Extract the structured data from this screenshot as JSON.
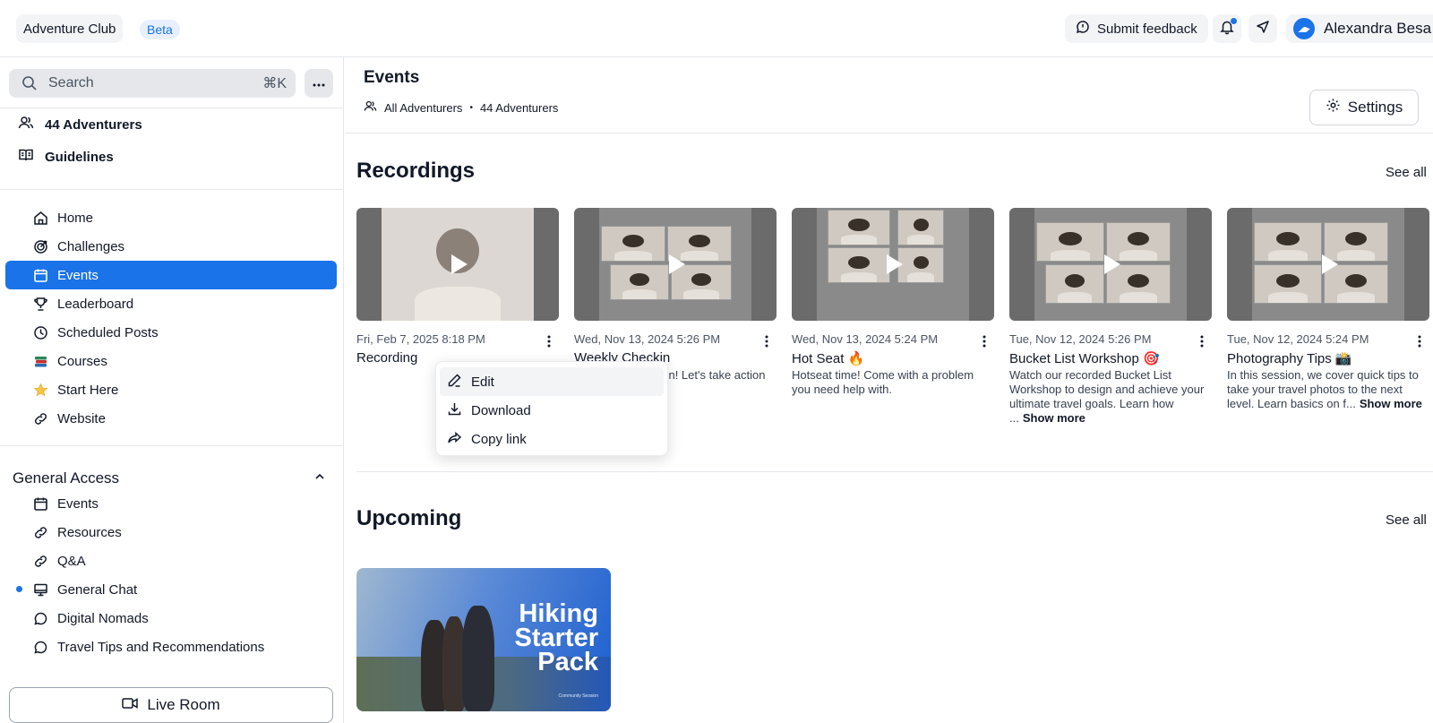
{
  "topbar": {
    "brand": "Adventure Club",
    "badge": "Beta",
    "feedback_label": "Submit feedback",
    "user_name": "Alexandra Besa",
    "colors": {
      "accent": "#1a73e8"
    }
  },
  "sidebar": {
    "search_placeholder": "Search",
    "search_shortcut": "⌘K",
    "meta": [
      {
        "label": "44 Adventurers",
        "icon": "people-icon"
      },
      {
        "label": "Guidelines",
        "icon": "book-icon"
      }
    ],
    "nav": [
      {
        "label": "Home",
        "icon": "home-icon"
      },
      {
        "label": "Challenges",
        "icon": "target-icon"
      },
      {
        "label": "Events",
        "icon": "calendar-icon",
        "active": true
      },
      {
        "label": "Leaderboard",
        "icon": "trophy-icon"
      },
      {
        "label": "Scheduled Posts",
        "icon": "clock-icon"
      },
      {
        "label": "Courses",
        "icon": "books-emoji-icon"
      },
      {
        "label": "Start Here",
        "icon": "star-emoji-icon"
      },
      {
        "label": "Website",
        "icon": "link-icon"
      }
    ],
    "section_title": "General Access",
    "section_items": [
      {
        "label": "Events",
        "icon": "calendar-icon"
      },
      {
        "label": "Resources",
        "icon": "link-icon"
      },
      {
        "label": "Q&A",
        "icon": "link-icon"
      },
      {
        "label": "General Chat",
        "icon": "monitor-icon",
        "unread": true
      },
      {
        "label": "Digital Nomads",
        "icon": "chat-bubble-icon"
      },
      {
        "label": "Travel Tips and Recommendations",
        "icon": "chat-bubble-icon"
      }
    ],
    "live_room_label": "Live Room"
  },
  "main": {
    "title": "Events",
    "breadcrumb": {
      "audience": "All Adventurers",
      "separator": "•",
      "count": "44 Adventurers"
    },
    "settings_label": "Settings",
    "recordings": {
      "title": "Recordings",
      "see_all": "See all",
      "items": [
        {
          "date": "Fri, Feb 7, 2025 8:18 PM",
          "title": "Recording",
          "desc": "",
          "show_more": ""
        },
        {
          "date": "Wed, Nov 13, 2024 5:26 PM",
          "title": "Weekly Checkin",
          "desc": "Our weekly checkin! Let's take action 💪",
          "show_more": ""
        },
        {
          "date": "Wed, Nov 13, 2024 5:24 PM",
          "title": "Hot Seat 🔥",
          "desc": "Hotseat time! Come with a problem you need help with.",
          "show_more": ""
        },
        {
          "date": "Tue, Nov 12, 2024 5:26 PM",
          "title": "Bucket List Workshop 🎯",
          "desc": "Watch our recorded Bucket List Workshop to design and achieve your ultimate travel goals. Learn how ...",
          "show_more": "Show more"
        },
        {
          "date": "Tue, Nov 12, 2024 5:24 PM",
          "title": "Photography Tips 📸",
          "desc": "In this session, we cover quick tips to take your travel photos to the next level. Learn basics on f...",
          "show_more": "Show more"
        }
      ]
    },
    "dropdown": {
      "items": [
        {
          "label": "Edit",
          "icon": "pencil-icon"
        },
        {
          "label": "Download",
          "icon": "download-icon"
        },
        {
          "label": "Copy link",
          "icon": "share-arrow-icon"
        }
      ]
    },
    "upcoming": {
      "title": "Upcoming",
      "see_all": "See all",
      "event": {
        "line1": "Hiking",
        "line2": "Starter",
        "line3": "Pack",
        "small": "Community Session"
      }
    }
  }
}
